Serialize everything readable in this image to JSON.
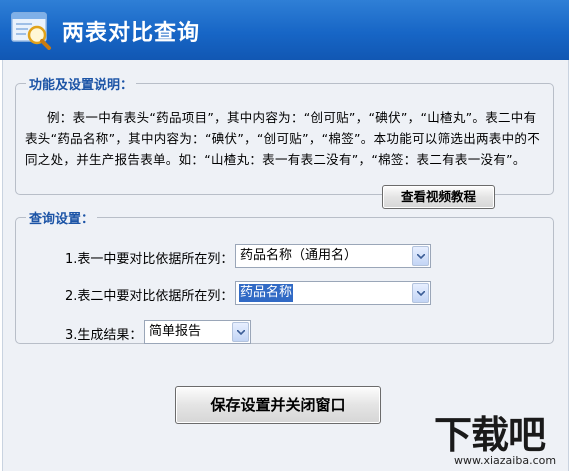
{
  "window": {
    "title": "两表对比查询",
    "icon": "table-search-icon"
  },
  "info_section": {
    "legend": "功能及设置说明：",
    "description": "例：表一中有表头“药品项目”，其中内容为：“创可贴”，“碘伏”，“山楂丸”。表二中有表头“药品名称”，其中内容为：“碘伏”，“创可贴”，“棉签”。本功能可以筛选出两表中的不同之处，并生产报告表单。如：“山楂丸：表一有表二没有”，“棉签：表二有表一没有”。",
    "video_button": "查看视频教程"
  },
  "query_section": {
    "legend": "查询设置：",
    "row1": {
      "label": "1.表一中要对比依据所在列：",
      "value": "药品名称（通用名）"
    },
    "row2": {
      "label": "2.表二中要对比依据所在列：",
      "value": "药品名称"
    },
    "row3": {
      "label": "3.生成结果：",
      "value": "简单报告"
    }
  },
  "save_button": "保存设置并关闭窗口",
  "watermark": {
    "text": "下载吧",
    "url": "www.xiazaiba.com"
  },
  "colors": {
    "titlebar": "#1766c6",
    "legend": "#1c54a6",
    "selection": "#316ac5",
    "panel_bg": "#eef1f6"
  }
}
